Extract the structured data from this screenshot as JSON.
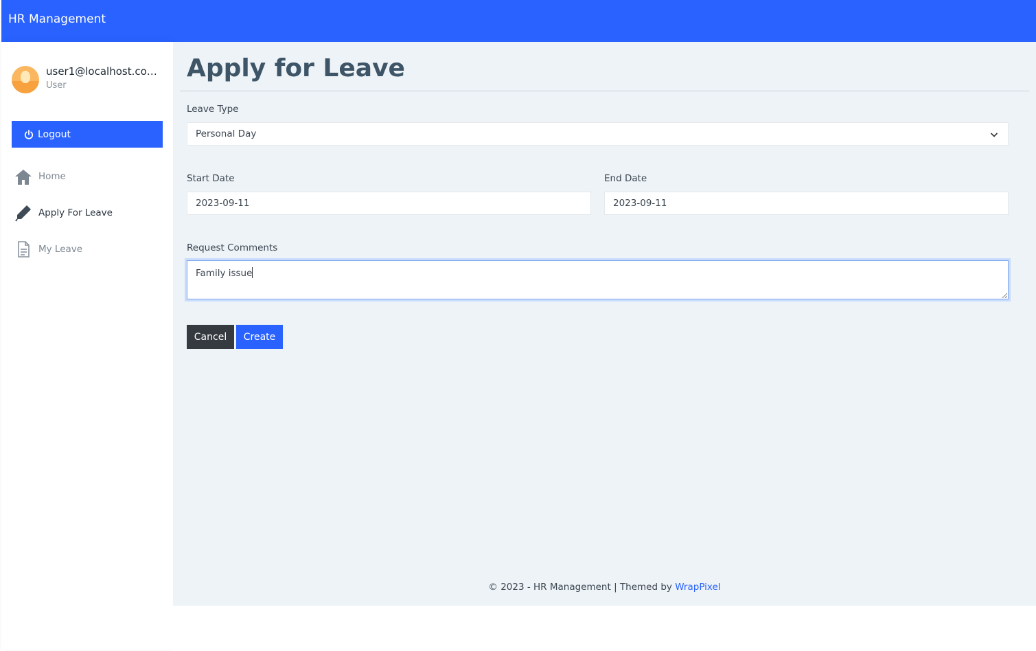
{
  "app": {
    "brand": "HR Management"
  },
  "user": {
    "email": "user1@localhost.com...",
    "role": "User"
  },
  "sidebar": {
    "logout_label": "Logout",
    "items": [
      {
        "label": "Home",
        "icon": "home-icon",
        "active": false
      },
      {
        "label": "Apply For Leave",
        "icon": "pencil-icon",
        "active": true
      },
      {
        "label": "My Leave",
        "icon": "document-icon",
        "active": false
      }
    ]
  },
  "page": {
    "title": "Apply for Leave"
  },
  "form": {
    "leave_type": {
      "label": "Leave Type",
      "value": "Personal Day"
    },
    "start_date": {
      "label": "Start Date",
      "value": "2023-09-11"
    },
    "end_date": {
      "label": "End Date",
      "value": "2023-09-11"
    },
    "comments": {
      "label": "Request Comments",
      "value": "Family issue"
    },
    "cancel_label": "Cancel",
    "create_label": "Create"
  },
  "footer": {
    "text": "© 2023 - HR Management | Themed by ",
    "link": "WrapPixel"
  },
  "colors": {
    "primary": "#2962ff",
    "dark": "#343a40",
    "content_bg": "#edf3f7"
  }
}
